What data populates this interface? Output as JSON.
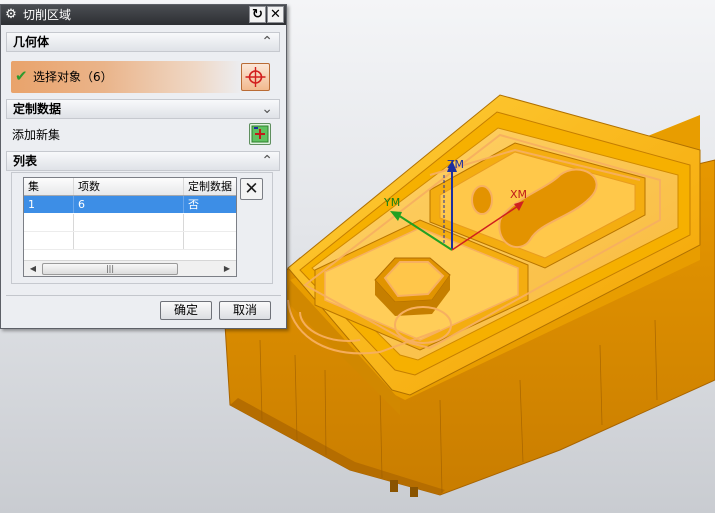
{
  "dialog": {
    "title": "切削区域",
    "geometry_section": "几何体",
    "select_label": "选择对象（6）",
    "custom_data_section": "定制数据",
    "add_set_label": "添加新集",
    "list_section": "列表",
    "table": {
      "columns": [
        "集",
        "项数",
        "定制数据"
      ],
      "rows": [
        [
          "1",
          "6",
          "否"
        ]
      ]
    },
    "ok_label": "确定",
    "cancel_label": "取消"
  },
  "viewport": {
    "axis_labels": {
      "z": "ZM",
      "y": "YM",
      "x": "XM"
    },
    "part_color": "#f2a500",
    "highlight_color": "#f7b060"
  },
  "icons": {
    "title": "gear-icon",
    "reset": "reset-icon",
    "close": "close-icon",
    "select_state": "check-icon",
    "select_target": "crosshair-icon",
    "add_set": "add-set-icon",
    "delete": "delete-icon"
  }
}
